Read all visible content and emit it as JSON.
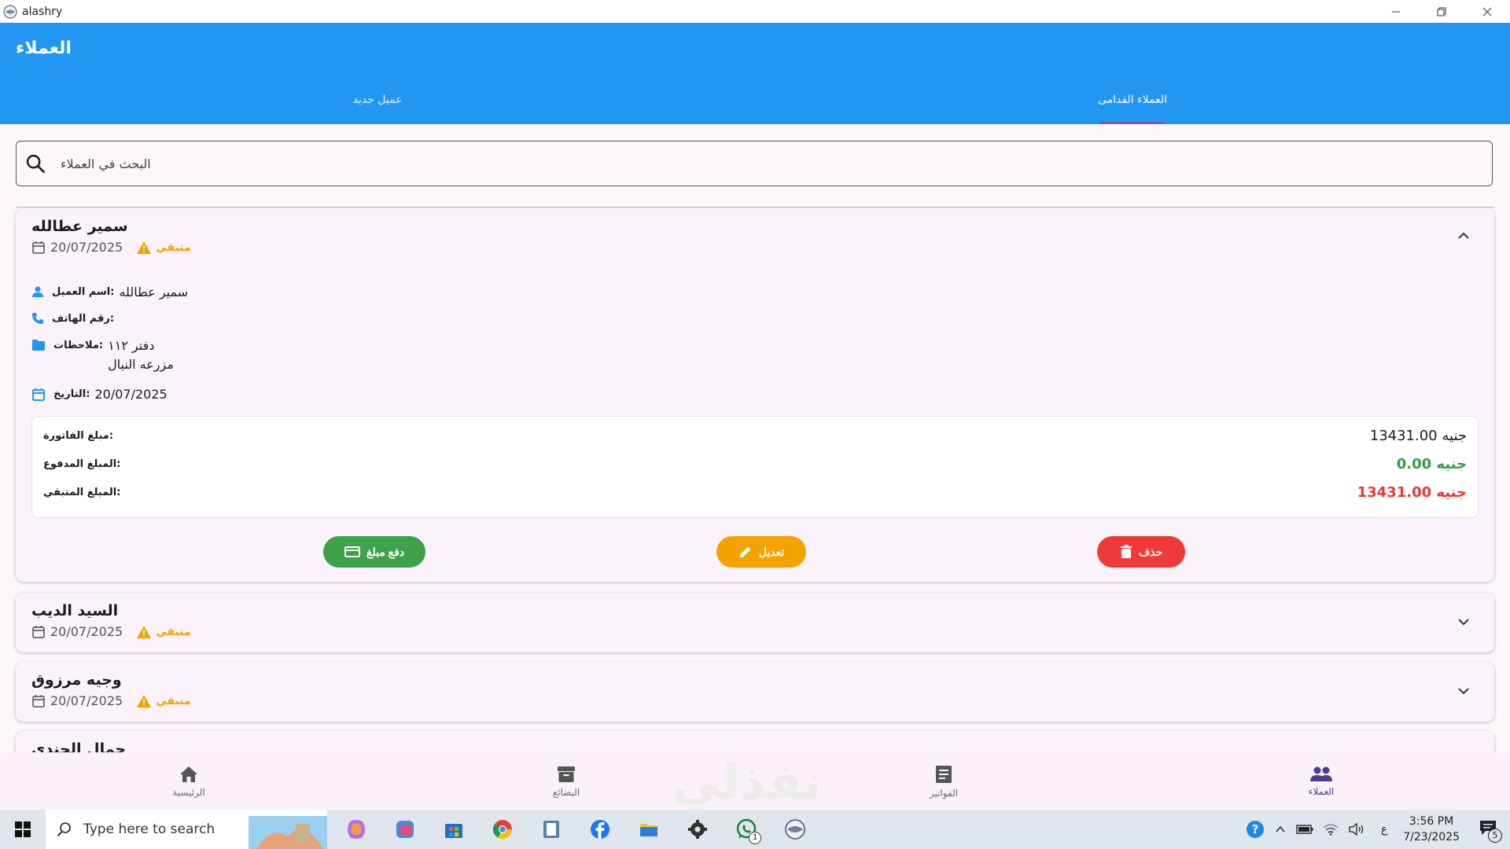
{
  "window": {
    "title": "alashry"
  },
  "appbar": {
    "title": "العملاء",
    "tabs": [
      {
        "label": "عميل جديد"
      },
      {
        "label": "العملاء القدامى"
      }
    ]
  },
  "search": {
    "placeholder": "البحث في العملاء"
  },
  "customers": [
    {
      "name": "سمير عطالله",
      "date": "20/07/2025",
      "status": "متبقي",
      "expanded": true,
      "details": {
        "name_label": "اسم العميل:",
        "name_value": "سمير عطالله",
        "phone_label": "رقم الهاتف:",
        "phone_value": "",
        "notes_label": "ملاحظات:",
        "notes_line1": "دفتر ١١٢",
        "notes_line2": "مزرعه النيال",
        "date_label": "التاريخ:",
        "date_value": "20/07/2025"
      },
      "summary": {
        "invoice_label": "مبلغ الفاتورة:",
        "invoice_value": "13431.00 جنيه",
        "paid_label": "المبلغ المدفوع:",
        "paid_value": "0.00 جنيه",
        "remaining_label": "المبلغ المتبقي:",
        "remaining_value": "13431.00 جنيه"
      },
      "actions": {
        "pay": "دفع مبلغ",
        "edit": "تعديل",
        "delete": "حذف"
      }
    },
    {
      "name": "السيد الديب",
      "date": "20/07/2025",
      "status": "متبقي",
      "expanded": false
    },
    {
      "name": "وجيه مرزوق",
      "date": "20/07/2025",
      "status": "متبقي",
      "expanded": false
    },
    {
      "name": "جمال الجندي",
      "partial": true
    }
  ],
  "bottom_nav": [
    {
      "label": "الرئيسية",
      "icon": "home-icon"
    },
    {
      "label": "البضائع",
      "icon": "archive-icon"
    },
    {
      "label": "الفواتير",
      "icon": "receipt-icon"
    },
    {
      "label": "العملاء",
      "icon": "people-icon",
      "active": true
    }
  ],
  "watermark": "نفذلي",
  "taskbar": {
    "search_placeholder": "Type here to search",
    "whatsapp_badge": "1",
    "lang": "ع",
    "time": "3:56 PM",
    "date": "7/23/2025",
    "notifications": "5"
  },
  "colors": {
    "primary": "#2196f3",
    "warning": "#f5a000",
    "paid": "#2e9e3e",
    "remaining": "#e53935",
    "pay_button": "#3fa14a",
    "edit_button": "#f5a300",
    "delete_button": "#f03a3a"
  }
}
